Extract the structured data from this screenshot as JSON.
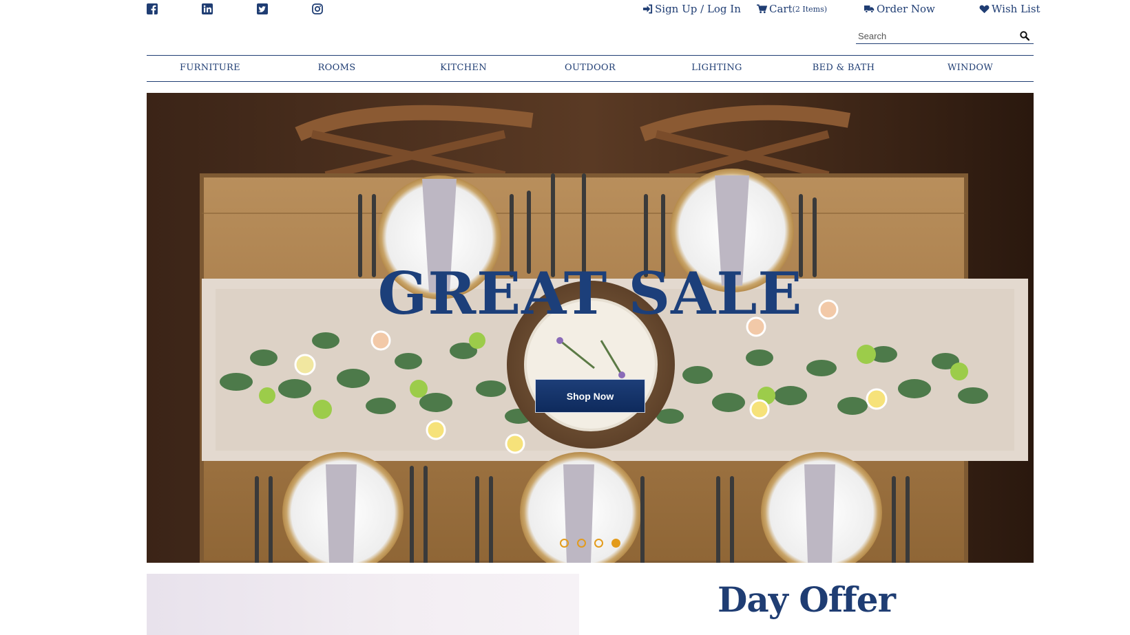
{
  "social": {
    "icons": [
      "facebook-icon",
      "linkedin-icon",
      "twitter-icon",
      "instagram-icon"
    ]
  },
  "topnav": {
    "signup": "Sign Up / Log In",
    "cart": "Cart",
    "cart_count": "(2 Items)",
    "order": "Order Now",
    "wishlist": "Wish List"
  },
  "search": {
    "placeholder": "Search",
    "value": ""
  },
  "nav": {
    "items": [
      "FURNITURE",
      "ROOMS",
      "KITCHEN",
      "OUTDOOR",
      "LIGHTING",
      "BED & BATH",
      "WINDOW"
    ]
  },
  "hero": {
    "title": "GREAT SALE",
    "button": "Shop Now",
    "slides": 4,
    "active_slide": 4
  },
  "offer": {
    "title": "Day Offer"
  },
  "colors": {
    "brand": "#1f3d73",
    "accent": "#e39b1b",
    "button": "#12316a"
  }
}
